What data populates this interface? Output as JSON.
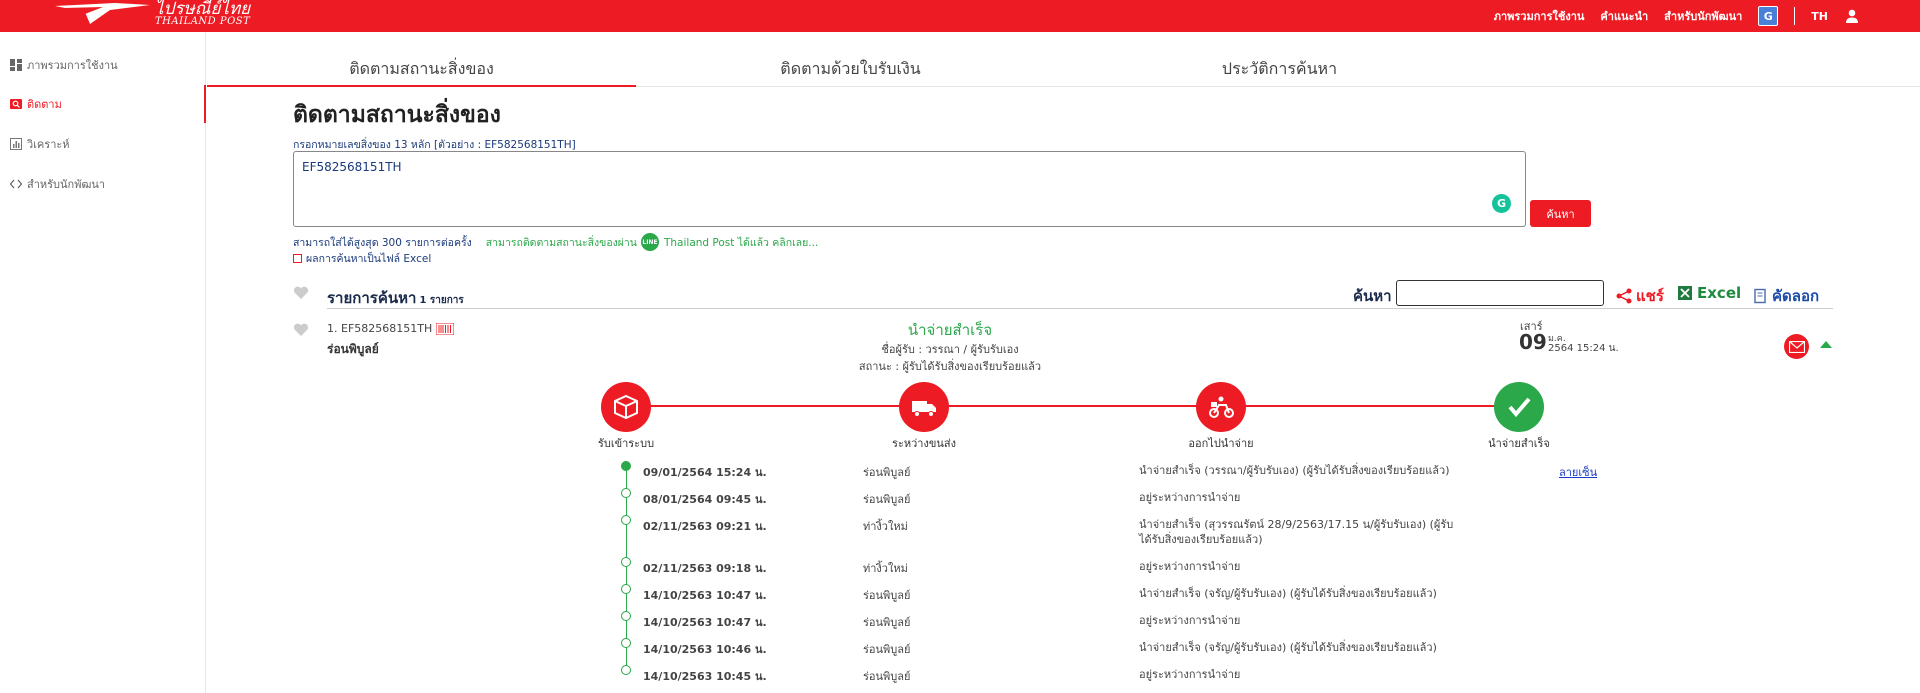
{
  "header": {
    "logo_thai": "ไปรษณีย์ไทย",
    "logo_en": "THAILAND POST",
    "nav": [
      "ภาพรวมการใช้งาน",
      "คำแนะนำ",
      "สำหรับนักพัฒนา"
    ],
    "translate_icon": "G",
    "lang": "TH",
    "colors": {
      "brand": "#ed1c24",
      "success": "#2aa84a",
      "link": "#1a3acc"
    }
  },
  "sidebar": {
    "items": [
      {
        "label": "ภาพรวมการใช้งาน",
        "icon": "dashboard-icon"
      },
      {
        "label": "ติดตาม",
        "icon": "track-icon",
        "active": true
      },
      {
        "label": "วิเคราะห์",
        "icon": "chart-icon"
      },
      {
        "label": "สำหรับนักพัฒนา",
        "icon": "code-icon"
      }
    ]
  },
  "tabs": [
    {
      "label": "ติดตามสถานะสิ่งของ",
      "active": true
    },
    {
      "label": "ติดตามด้วยใบรับเงิน"
    },
    {
      "label": "ประวัติการค้นหา"
    }
  ],
  "search": {
    "title": "ติดตามสถานะสิ่งของ",
    "hint": "กรอกหมายเลขสิ่งของ 13 หลัก [ตัวอย่าง : EF582568151TH]",
    "value": "EF582568151TH",
    "button_label": "ค้นหา",
    "note_limit": "สามารถใส่ได้สูงสุด 300 รายการต่อครั้ง",
    "note_line": "สามารถติดตามสถานะสิ่งของผ่าน",
    "line_badge": "LINE",
    "note_line_link": "Thailand Post ได้แล้ว คลิกเลย...",
    "excel_option": "ผลการค้นหาเป็นไฟล์ Excel"
  },
  "results": {
    "title": "รายการค้นหา",
    "count": "1 รายการ",
    "search_label": "ค้นหา",
    "search_value": "",
    "share_label": "แชร์",
    "excel_label": "Excel",
    "copy_label": "คัดลอก"
  },
  "item": {
    "number": "1. EF582568151TH",
    "office": "ร่อนพิบูลย์",
    "status": "นำจ่ายสำเร็จ",
    "receiver": "ชื่อผู้รับ : วรรณา / ผู้รับรับเอง",
    "state": "สถานะ : ผู้รับได้รับสิ่งของเรียบร้อยแล้ว",
    "day": "เสาร์",
    "date_num": "09",
    "month": "ม.ค.",
    "year_time": "2564 15:24 น."
  },
  "steps": [
    {
      "label": "รับเข้าระบบ",
      "icon": "box-icon"
    },
    {
      "label": "ระหว่างขนส่ง",
      "icon": "truck-icon"
    },
    {
      "label": "ออกไปนำจ่าย",
      "icon": "motorbike-icon"
    },
    {
      "label": "นำจ่ายสำเร็จ",
      "icon": "check-icon",
      "done": true
    }
  ],
  "timeline": [
    {
      "date": "09/01/2564 15:24 น.",
      "location": "ร่อนพิบูลย์",
      "desc": "นำจ่ายสำเร็จ (วรรณา/ผู้รับรับเอง) (ผู้รับได้รับสิ่งของเรียบร้อยแล้ว)",
      "link": "ลายเซ็น",
      "latest": true
    },
    {
      "date": "08/01/2564 09:45 น.",
      "location": "ร่อนพิบูลย์",
      "desc": "อยู่ระหว่างการนำจ่าย"
    },
    {
      "date": "02/11/2563 09:21 น.",
      "location": "ท่างิ้วใหม่",
      "desc": "นำจ่ายสำเร็จ (สุวรรณรัตน์ 28/9/2563/17.15 น/ผู้รับรับเอง) (ผู้รับได้รับสิ่งของเรียบร้อยแล้ว)"
    },
    {
      "date": "02/11/2563 09:18 น.",
      "location": "ท่างิ้วใหม่",
      "desc": "อยู่ระหว่างการนำจ่าย"
    },
    {
      "date": "14/10/2563 10:47 น.",
      "location": "ร่อนพิบูลย์",
      "desc": "นำจ่ายสำเร็จ (จรัญ/ผู้รับรับเอง) (ผู้รับได้รับสิ่งของเรียบร้อยแล้ว)"
    },
    {
      "date": "14/10/2563 10:47 น.",
      "location": "ร่อนพิบูลย์",
      "desc": "อยู่ระหว่างการนำจ่าย"
    },
    {
      "date": "14/10/2563 10:46 น.",
      "location": "ร่อนพิบูลย์",
      "desc": "นำจ่ายสำเร็จ (จรัญ/ผู้รับรับเอง) (ผู้รับได้รับสิ่งของเรียบร้อยแล้ว)"
    },
    {
      "date": "14/10/2563 10:45 น.",
      "location": "ร่อนพิบูลย์",
      "desc": "อยู่ระหว่างการนำจ่าย"
    }
  ]
}
